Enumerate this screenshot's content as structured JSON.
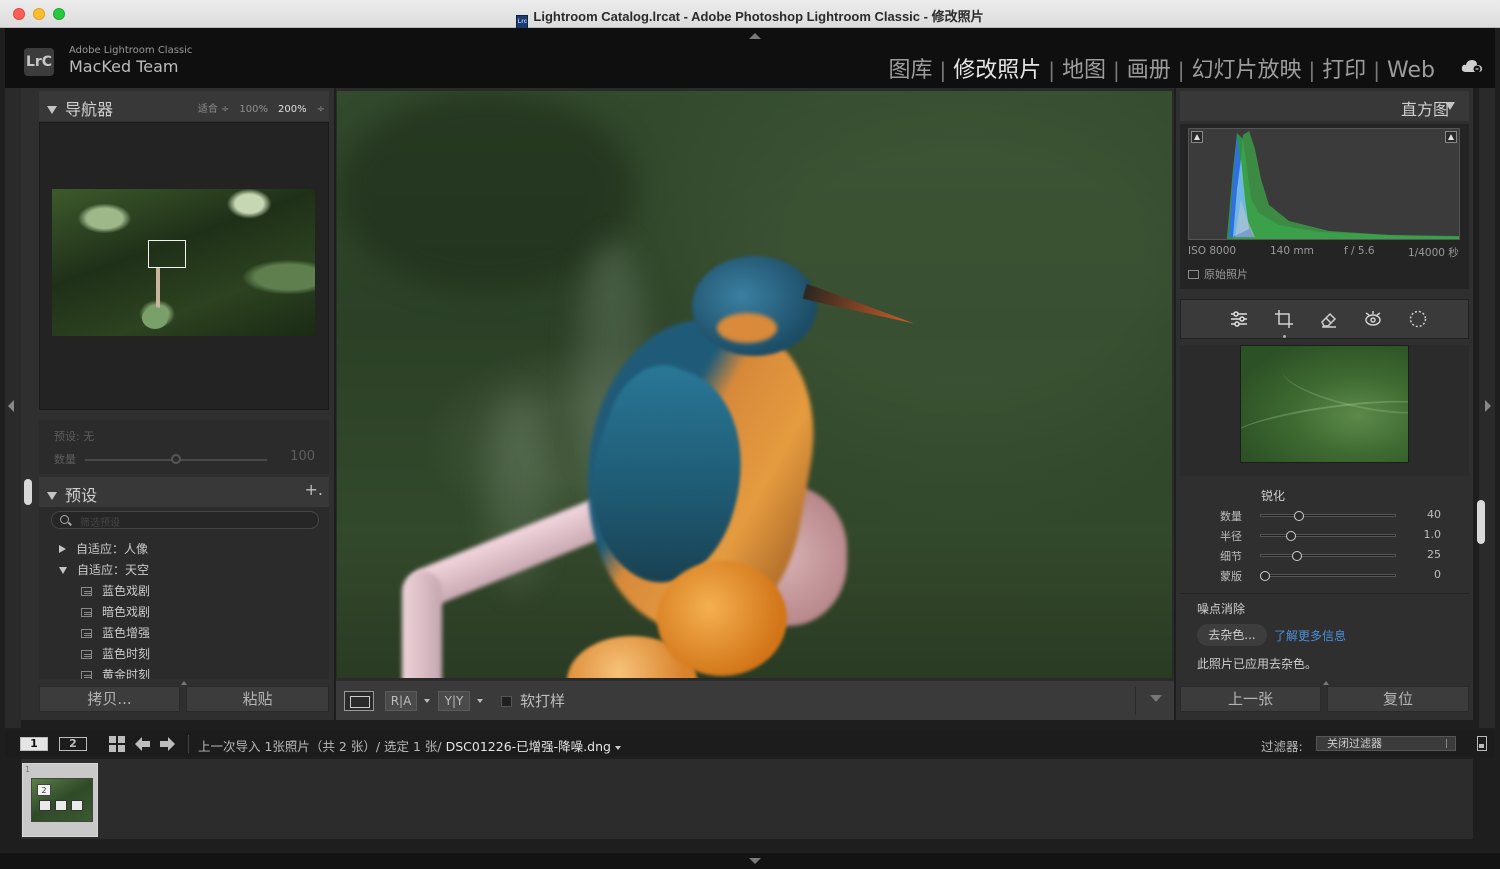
{
  "window": {
    "title": "Lightroom Catalog.lrcat - Adobe Photoshop Lightroom Classic - 修改照片",
    "doc_icon_text": "Lrc"
  },
  "identity": {
    "logo": "LrC",
    "product": "Adobe Lightroom Classic",
    "team": "MacKed Team"
  },
  "modules": [
    {
      "label": "图库",
      "active": false
    },
    {
      "label": "修改照片",
      "active": true
    },
    {
      "label": "地图",
      "active": false
    },
    {
      "label": "画册",
      "active": false
    },
    {
      "label": "幻灯片放映",
      "active": false
    },
    {
      "label": "打印",
      "active": false
    },
    {
      "label": "Web",
      "active": false
    }
  ],
  "navigator": {
    "title": "导航器",
    "zoom": [
      "适合 ÷",
      "100%",
      "200%",
      "÷"
    ],
    "selected_zoom": "200%"
  },
  "preset_amount": {
    "preset_label": "预设: 无",
    "amount_label": "数量",
    "amount_value": "100",
    "amount_fraction": 0.5
  },
  "presets": {
    "title": "预设",
    "add": "+.",
    "search_placeholder": "筛选预设",
    "groups": [
      {
        "label": "自适应：人像",
        "expanded": false
      },
      {
        "label": "自适应：天空",
        "expanded": true
      }
    ],
    "items": [
      "蓝色戏剧",
      "暗色戏剧",
      "蓝色增强",
      "蓝色时刻",
      "黄金时刻"
    ]
  },
  "left_buttons": {
    "copy": "拷贝...",
    "paste": "粘贴"
  },
  "toolbar": {
    "ra": "R|A",
    "yy": "Y|Y",
    "soft_proof": "软打样"
  },
  "histogram": {
    "title": "直方图",
    "iso": "ISO 8000",
    "focal": "140 mm",
    "aperture": "f / 5.6",
    "shutter": "1/4000 秒",
    "original": "原始照片"
  },
  "tools": [
    "sliders-icon",
    "crop-icon",
    "eraser-icon",
    "redeye-icon",
    "mask-icon"
  ],
  "sharpening": {
    "title": "锐化",
    "sliders": [
      {
        "label": "数量",
        "value": "40",
        "fraction": 0.27
      },
      {
        "label": "半径",
        "value": "1.0",
        "fraction": 0.21
      },
      {
        "label": "细节",
        "value": "25",
        "fraction": 0.25
      },
      {
        "label": "蒙版",
        "value": "0",
        "fraction": 0.0
      }
    ]
  },
  "noise_reduction": {
    "title": "噪点消除",
    "denoise_button": "去杂色...",
    "learn_more": "了解更多信息",
    "status": "此照片已应用去杂色。"
  },
  "right_buttons": {
    "previous": "上一张",
    "reset": "复位"
  },
  "filmbar": {
    "screen1": "1",
    "screen2": "2",
    "path": "上一次导入  1张照片（共 2 张）/ 选定 1 张/ ",
    "filename": "DSC01226-已增强-降噪.dng",
    "filter_label": "过滤器:",
    "filter_value": "关闭过滤器"
  },
  "filmstrip": {
    "cell_number": "1",
    "badge": "2"
  },
  "colors": {
    "accent_link": "#4d8fd9",
    "panel": "#2f2f2f",
    "header": "#0f0f0f"
  }
}
